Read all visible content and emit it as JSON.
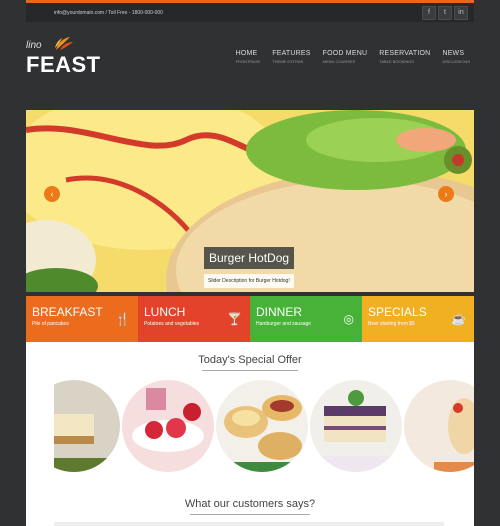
{
  "topbar": {
    "contact": "info@yourdomain.com / Toll Free - 1800-000-000",
    "social": [
      {
        "icon": "facebook-icon",
        "glyph": "f"
      },
      {
        "icon": "twitter-icon",
        "glyph": "t"
      },
      {
        "icon": "linkedin-icon",
        "glyph": "in"
      }
    ]
  },
  "logo": {
    "small": "lino",
    "big": "FEAST"
  },
  "nav": [
    {
      "label": "HOME",
      "sub": "FRONTPAGE"
    },
    {
      "label": "FEATURES",
      "sub": "THEME EXTRAS"
    },
    {
      "label": "FOOD MENU",
      "sub": "MENU COURSES"
    },
    {
      "label": "RESERVATION",
      "sub": "TABLE BOOKINGS"
    },
    {
      "label": "NEWS",
      "sub": "DISCUSSIONS"
    }
  ],
  "slider": {
    "title": "Burger HotDog",
    "description": "Slider Description for Burger Hotdog!",
    "prev_glyph": "‹",
    "next_glyph": "›"
  },
  "meals": [
    {
      "title": "BREAKFAST",
      "desc": "Pile of pancakes",
      "icon": "fork-knife-icon",
      "glyph": "🍴",
      "color": "#ec6b1c"
    },
    {
      "title": "LUNCH",
      "desc": "Potatoes and vegetables",
      "icon": "cocktail-icon",
      "glyph": "🍸",
      "color": "#e2432a"
    },
    {
      "title": "DINNER",
      "desc": "Hamburger and sausage",
      "icon": "plate-icon",
      "glyph": "◎",
      "color": "#47b237"
    },
    {
      "title": "SPECIALS",
      "desc": "Beer starting from $5",
      "icon": "coffee-icon",
      "glyph": "☕",
      "color": "#f0b022"
    }
  ],
  "sections": {
    "offer_title": "Today's Special Offer",
    "testimonials_title": "What our customers says?"
  },
  "colors": {
    "accent": "#e8671c",
    "background": "#2f3133"
  }
}
